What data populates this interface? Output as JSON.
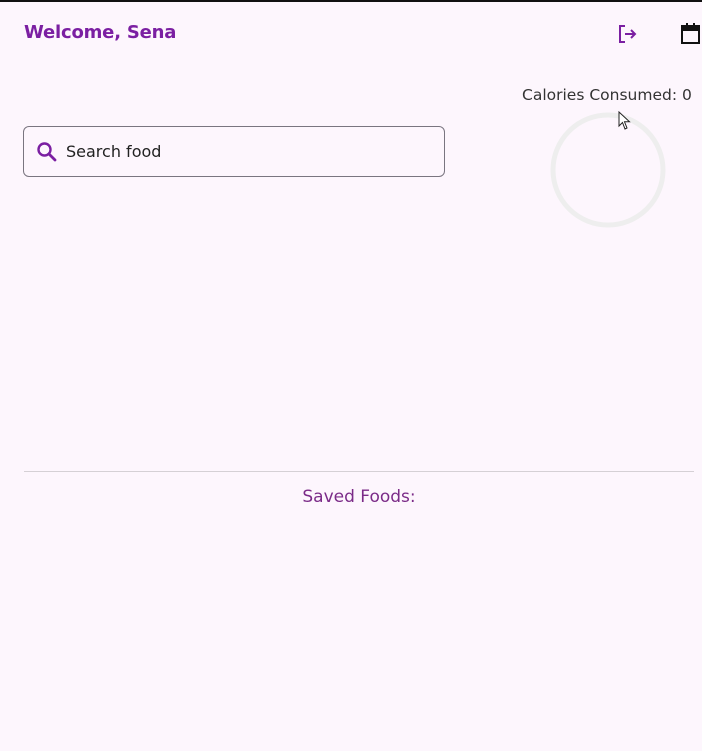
{
  "header": {
    "welcome": "Welcome, Sena",
    "logout_icon": "logout-icon",
    "calendar_icon": "calendar-icon"
  },
  "calories": {
    "label": "Calories Consumed: 0",
    "consumed": 0,
    "progress_fraction": 0
  },
  "search": {
    "placeholder": "Search food",
    "value": "",
    "icon": "search-icon"
  },
  "saved_foods": {
    "title": "Saved Foods:",
    "items": []
  },
  "colors": {
    "accent": "#7b1fa2",
    "background": "#fdf6fd",
    "ring_track": "#eeeeee"
  }
}
